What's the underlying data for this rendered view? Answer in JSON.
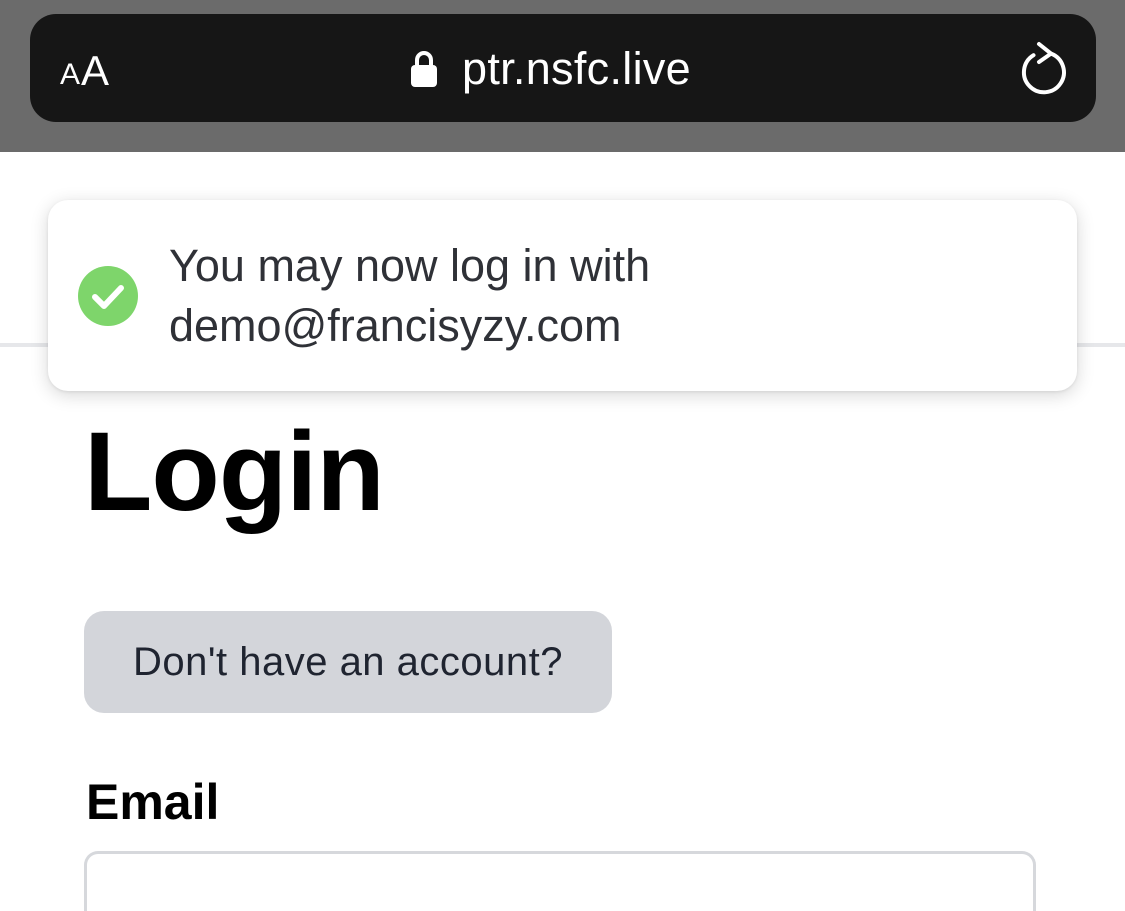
{
  "browser": {
    "text_size_small": "A",
    "text_size_large": "A",
    "url": "ptr.nsfc.live",
    "lock_icon": "lock-icon",
    "reload_icon": "reload-icon",
    "chrome_color": "#6b6b6b",
    "bar_color": "#161616"
  },
  "toast": {
    "icon": "check-circle-icon",
    "icon_color": "#7ed56b",
    "line1": "You may now log in with",
    "line2": "demo@francisyzy.com"
  },
  "page": {
    "title": "Login",
    "signup_link": "Don't have an account?",
    "email_label": "Email",
    "email_value": ""
  }
}
